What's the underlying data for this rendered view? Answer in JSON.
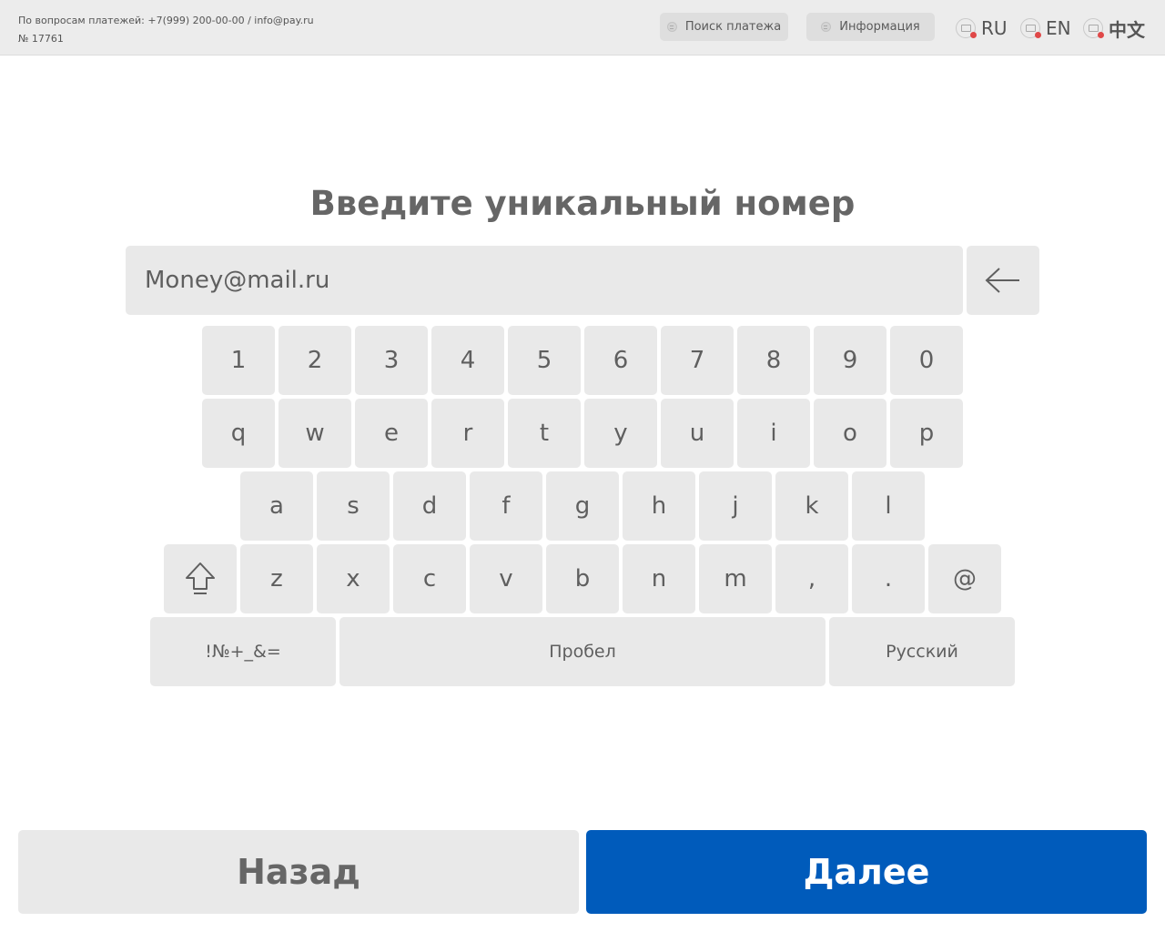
{
  "header": {
    "support_text": "По вопросам платежей: +7(999) 200-00-00 / info@pay.ru",
    "terminal_number": "№ 17761",
    "search_button": "Поиск платежа",
    "info_button": "Информация",
    "languages": [
      "RU",
      "EN",
      "中文"
    ]
  },
  "main": {
    "title": "Введите уникальный номер",
    "input_value": "Money@mail.ru"
  },
  "keyboard": {
    "row1": [
      "1",
      "2",
      "3",
      "4",
      "5",
      "6",
      "7",
      "8",
      "9",
      "0"
    ],
    "row2": [
      "q",
      "w",
      "e",
      "r",
      "t",
      "y",
      "u",
      "i",
      "o",
      "p"
    ],
    "row3": [
      "a",
      "s",
      "d",
      "f",
      "g",
      "h",
      "j",
      "k",
      "l"
    ],
    "row4": [
      "z",
      "x",
      "c",
      "v",
      "b",
      "n",
      "m",
      ",",
      ".",
      "@"
    ],
    "symbols": "!№+_&=",
    "space": "Пробел",
    "language": "Русский"
  },
  "footer": {
    "back": "Назад",
    "next": "Далее"
  },
  "colors": {
    "accent": "#005bbb",
    "key_bg": "#e9e9e9",
    "header_bg": "#ececec"
  }
}
